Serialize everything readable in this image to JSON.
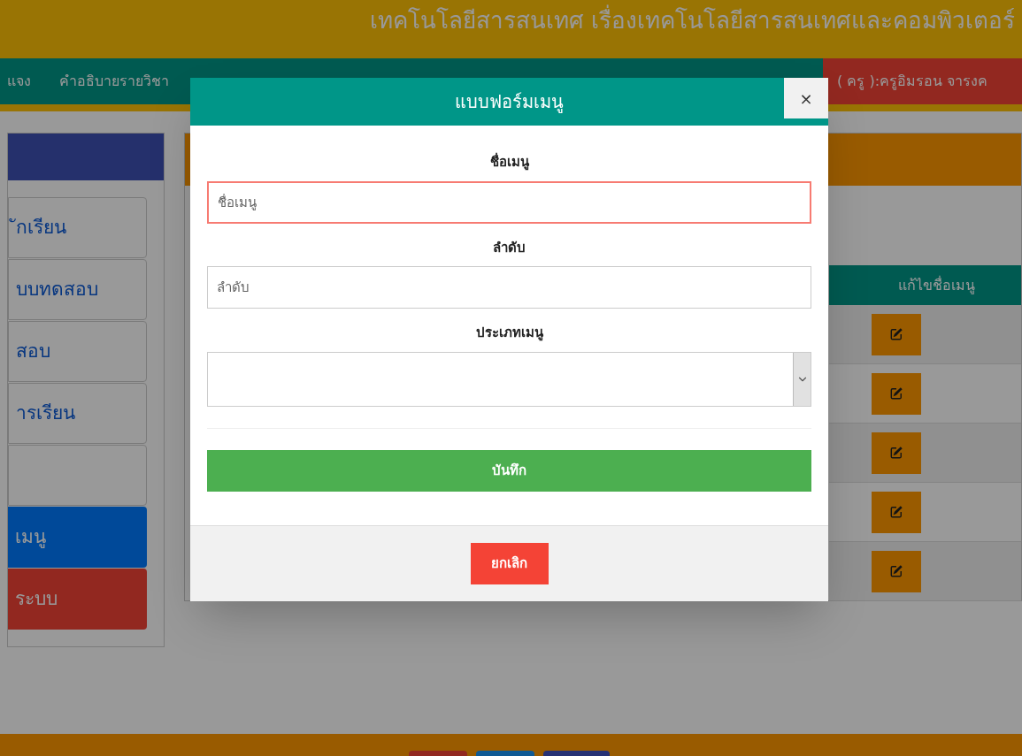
{
  "header": {
    "title": "เทคโนโลยีสารสนเทศ เรื่องเทคโนโลยีสารสนเทศและคอมพิวเตอร์"
  },
  "nav": {
    "items": [
      "แจง",
      "คำอธิบายรายวิชา"
    ],
    "user": "( ครู ):ครูอิมรอน จารงค"
  },
  "sidebar": {
    "items": [
      {
        "label": "ักเรียน",
        "kind": "plain"
      },
      {
        "label": "บบทดสอบ",
        "kind": "plain"
      },
      {
        "label": "สอบ",
        "kind": "plain"
      },
      {
        "label": "ารเรียน",
        "kind": "plain"
      },
      {
        "kind": "plain"
      },
      {
        "label": "เมนู",
        "kind": "active"
      },
      {
        "label": "ระบบ",
        "kind": "logout"
      }
    ]
  },
  "table": {
    "columns": [
      "แก้ไขชื่อเมนู"
    ]
  },
  "modal": {
    "title": "แบบฟอร์มเมนู",
    "close": "×",
    "fields": [
      {
        "label": "ชื่อเมนู",
        "kind": "text",
        "placeholder": "ชื่อเมนู",
        "invalid": true
      },
      {
        "label": "ลำดับ",
        "kind": "text",
        "placeholder": "ลำดับ",
        "invalid": false
      },
      {
        "label": "ประเภทเมนู",
        "kind": "select",
        "invalid": false
      }
    ],
    "save": "บันทึก",
    "cancel": "ยกเลิก"
  }
}
